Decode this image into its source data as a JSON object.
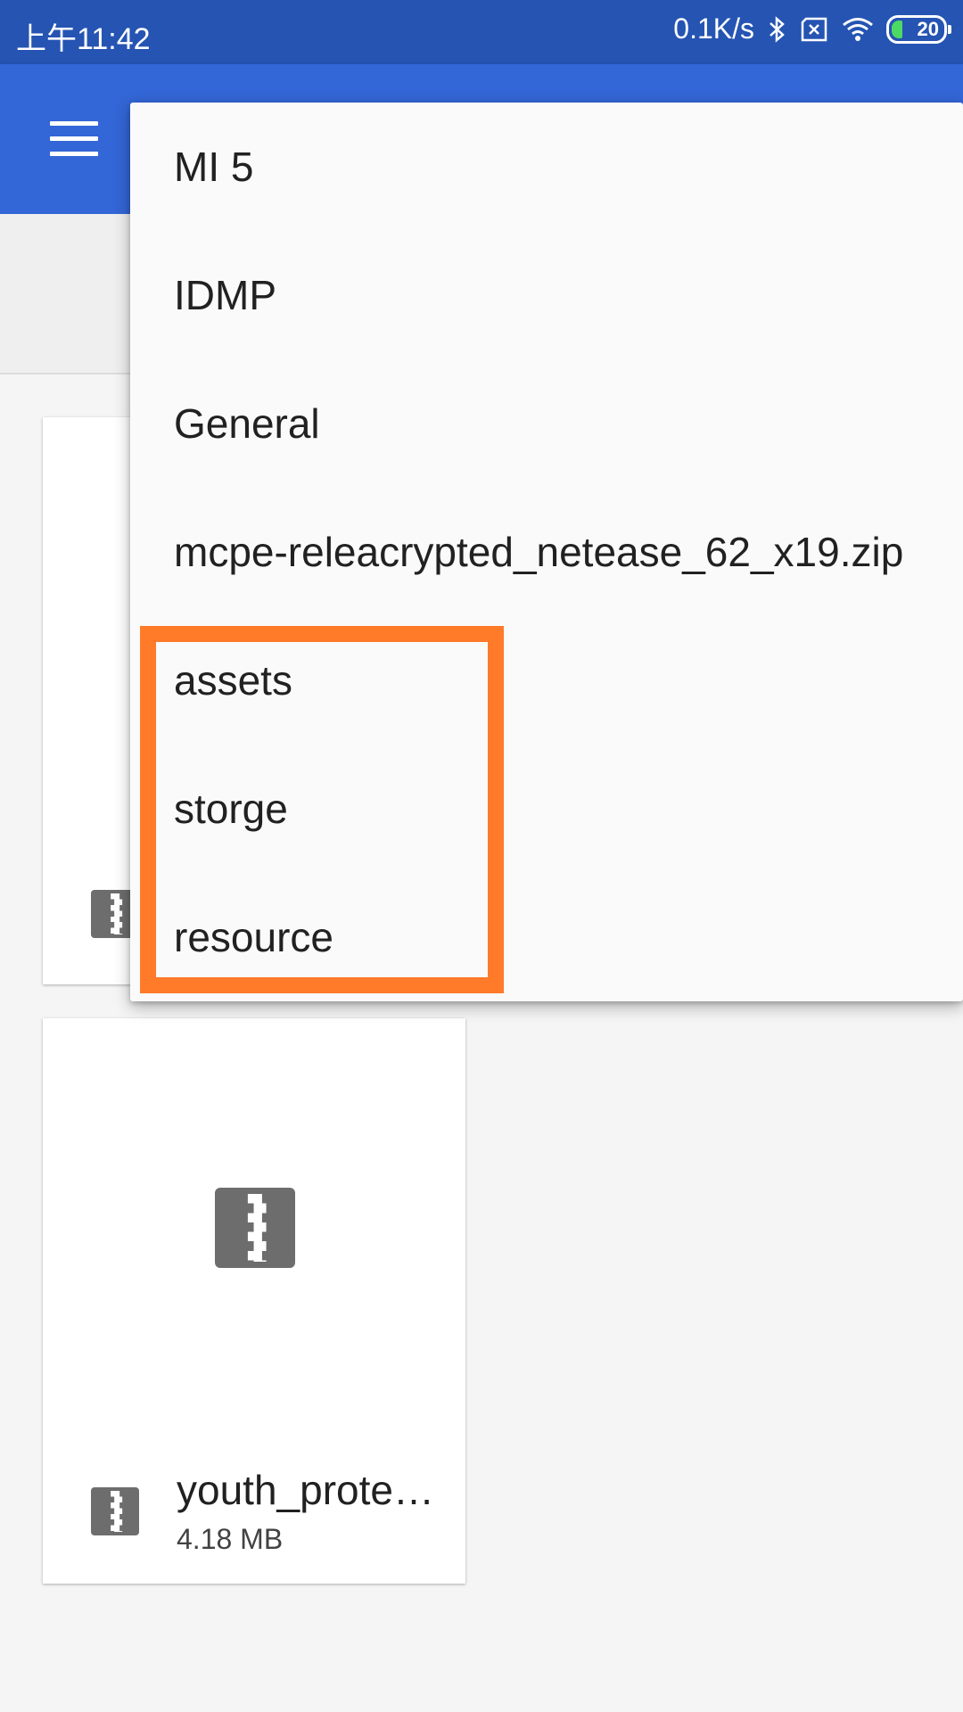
{
  "status_bar": {
    "time": "上午11:42",
    "net_speed": "0.1K/s",
    "battery": "20",
    "icons": [
      "bluetooth-icon",
      "sim-blocked-icon",
      "wifi-icon",
      "battery-icon"
    ]
  },
  "app_bar": {
    "menu_icon": "menu-icon"
  },
  "files": [
    {
      "name": "",
      "size": "",
      "icon": "zip-file-icon"
    },
    {
      "name": "youth_prote…",
      "size": "4.18 MB",
      "icon": "zip-file-icon"
    }
  ],
  "dropdown": {
    "items": [
      {
        "label": "MI 5"
      },
      {
        "label": "IDMP"
      },
      {
        "label": "General"
      },
      {
        "label": "mcpe-releacrypted_netease_62_x19.zip"
      },
      {
        "label": "assets"
      },
      {
        "label": "storge"
      },
      {
        "label": "resource"
      }
    ]
  },
  "colors": {
    "status_bar": "#2554b3",
    "app_bar": "#3366d6",
    "highlight": "#ff7a29",
    "zip_icon": "#6d6d6d"
  }
}
